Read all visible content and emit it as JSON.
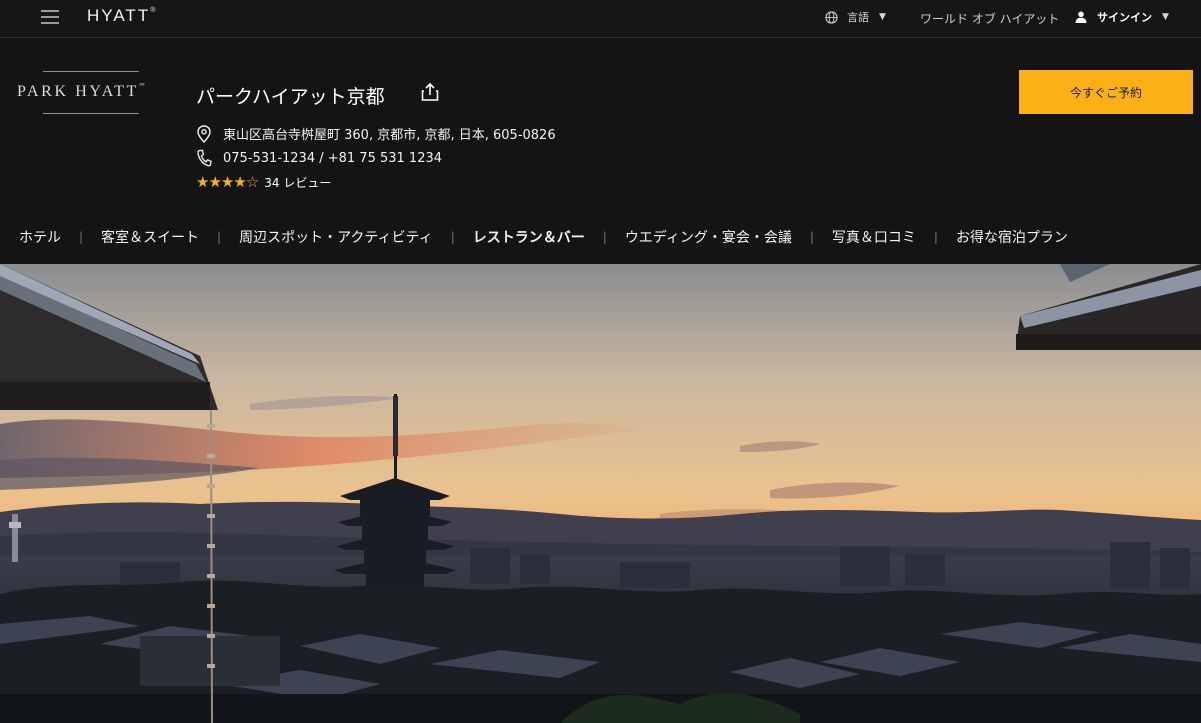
{
  "topbar": {
    "brand": "HYATT",
    "brand_mark": "®",
    "language_label": "言語",
    "world_of_hyatt": "ワールド オブ ハイアット",
    "sign_in": "サインイン"
  },
  "property": {
    "logo_text": "PARK HYATT",
    "logo_mark": "™",
    "name": "パークハイアット京都",
    "address": "東山区高台寺桝屋町 360, 京都市, 京都, 日本, 605-0826",
    "phone": "075-531-1234 / +81 75 531 1234",
    "rating_stars": "★★★★☆",
    "rating_value": 4,
    "reviews": "34 レビュー",
    "book_button": "今すぐご予約"
  },
  "nav": {
    "items": [
      {
        "label": "ホテル",
        "active": false
      },
      {
        "label": "客室＆スイート",
        "active": false
      },
      {
        "label": "周辺スポット・アクティビティ",
        "active": false
      },
      {
        "label": "レストラン＆バー",
        "active": true
      },
      {
        "label": "ウエディング・宴会・会議",
        "active": false
      },
      {
        "label": "写真＆口コミ",
        "active": false
      },
      {
        "label": "お得な宿泊プラン",
        "active": false
      }
    ]
  },
  "colors": {
    "background": "#141414",
    "accent_button": "#fbb017",
    "star": "#f4b120"
  },
  "icons": {
    "menu": "hamburger-icon",
    "language": "globe-icon",
    "user": "user-icon",
    "share": "share-icon",
    "location": "location-pin-icon",
    "phone": "phone-icon"
  }
}
